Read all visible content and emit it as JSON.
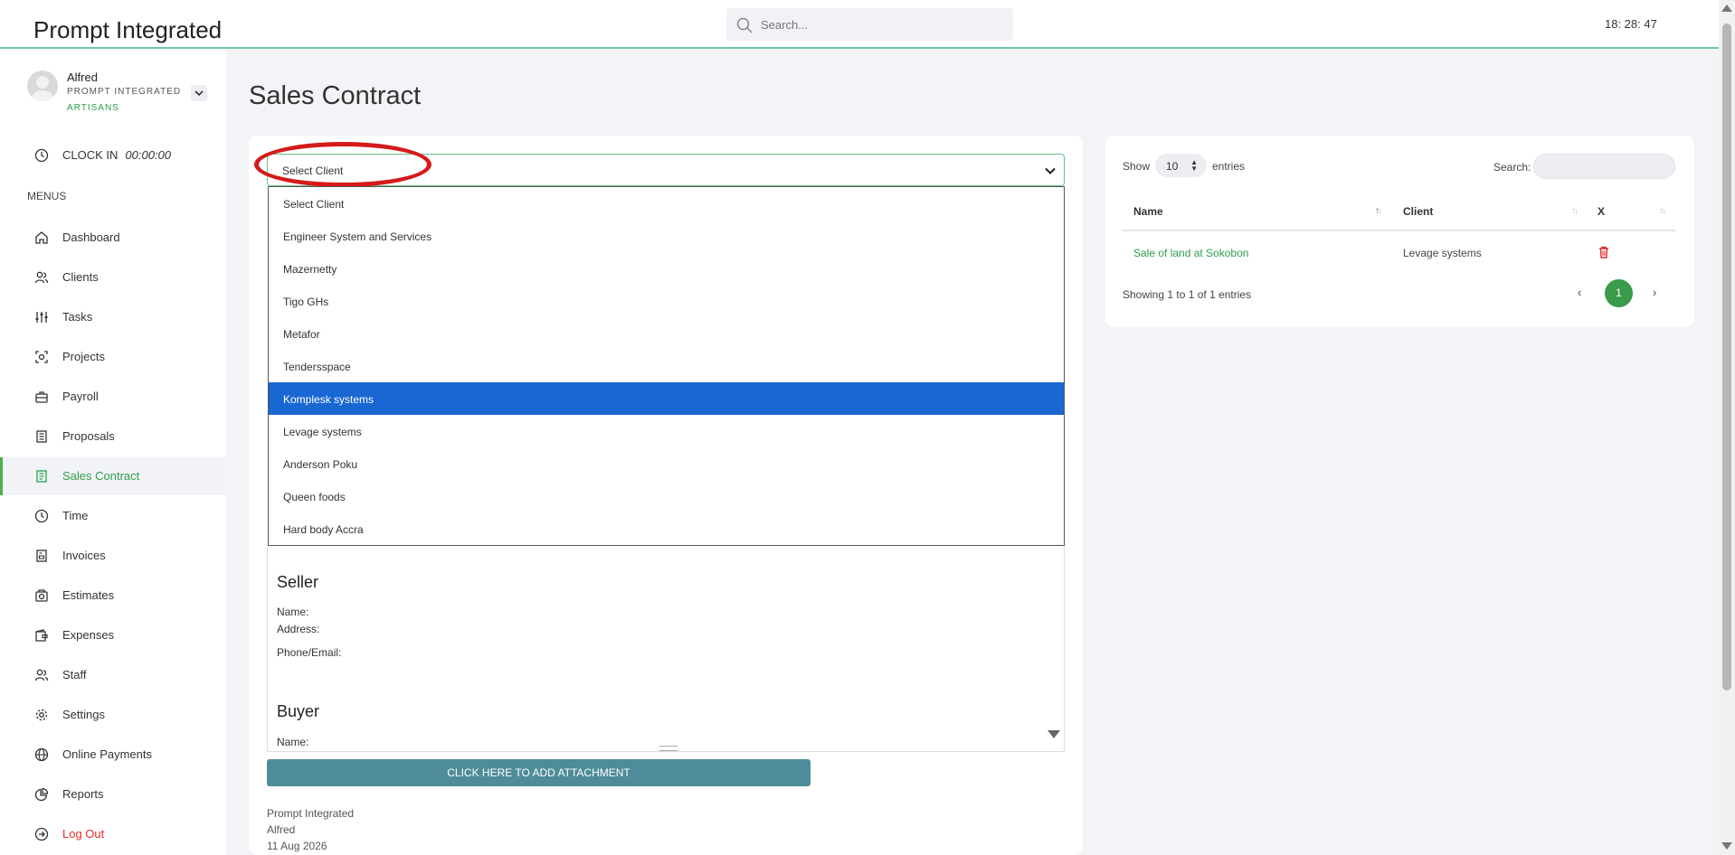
{
  "header": {
    "brand": "Prompt Integrated",
    "search_placeholder": "Search...",
    "clock": "18: 28: 47"
  },
  "user": {
    "name": "Alfred",
    "org_line1": "PROMPT INTEGRATED",
    "org_line2": "ARTISANS"
  },
  "clock_in": {
    "label": "CLOCK IN",
    "time": "00:00:00"
  },
  "menus_title": "MENUS",
  "nav": [
    {
      "label": "Dashboard",
      "icon": "home-icon"
    },
    {
      "label": "Clients",
      "icon": "users-icon"
    },
    {
      "label": "Tasks",
      "icon": "sliders-icon"
    },
    {
      "label": "Projects",
      "icon": "projects-icon"
    },
    {
      "label": "Payroll",
      "icon": "briefcase-icon"
    },
    {
      "label": "Proposals",
      "icon": "document-icon"
    },
    {
      "label": "Sales Contract",
      "icon": "contract-icon",
      "active": true
    },
    {
      "label": "Time",
      "icon": "clock-icon"
    },
    {
      "label": "Invoices",
      "icon": "invoice-icon"
    },
    {
      "label": "Estimates",
      "icon": "estimate-icon"
    },
    {
      "label": "Expenses",
      "icon": "wallet-icon"
    },
    {
      "label": "Staff",
      "icon": "users-icon"
    },
    {
      "label": "Settings",
      "icon": "gear-icon"
    },
    {
      "label": "Online Payments",
      "icon": "globe-icon"
    },
    {
      "label": "Reports",
      "icon": "pie-chart-icon"
    },
    {
      "label": "Log Out",
      "icon": "logout-icon"
    }
  ],
  "page_title": "Sales Contract",
  "client_select": {
    "selected_label": "Select Client",
    "options": [
      "Select Client",
      "Engineer System and Services",
      "Mazernetty",
      "Tigo GHs",
      "Metafor",
      "Tendersspace",
      "Komplesk systems",
      "Levage systems",
      "Anderson Poku",
      "Queen foods",
      "Hard body Accra"
    ],
    "highlighted_index": 6
  },
  "editor": {
    "seller_heading": "Seller",
    "seller_name": "Name:",
    "seller_address": "Address:",
    "seller_contact": "Phone/Email:",
    "buyer_heading": "Buyer",
    "buyer_name": "Name:"
  },
  "attach_button": "CLICK HERE TO ADD ATTACHMENT",
  "footer": {
    "company": "Prompt Integrated",
    "user": "Alfred",
    "date": "11 Aug 2026"
  },
  "table": {
    "show_label": "Show",
    "entries_value": "10",
    "entries_label": "entries",
    "search_label": "Search:",
    "columns": [
      "Name",
      "Client",
      "X"
    ],
    "rows": [
      {
        "name": "Sale of land at Sokobon",
        "client": "Levage systems"
      }
    ],
    "showing_text": "Showing 1 to 1 of 1 entries",
    "prev": "‹",
    "current_page": "1",
    "next": "›"
  }
}
